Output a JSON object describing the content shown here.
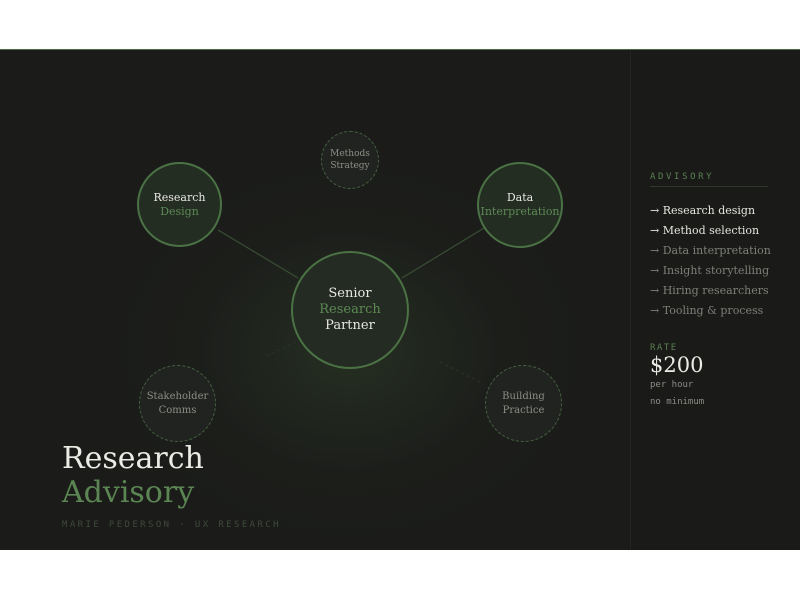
{
  "diagram": {
    "center": {
      "line1": "Senior",
      "line2": "Research",
      "line3": "Partner"
    },
    "nodes": {
      "research_design": {
        "line1": "Research",
        "line2": "Design"
      },
      "data_interpretation": {
        "line1": "Data",
        "line2": "Interpretation"
      },
      "methods_strategy": {
        "line1": "Methods",
        "line2": "Strategy"
      },
      "stakeholder_comms": {
        "line1": "Stakeholder",
        "line2": "Comms"
      },
      "building_practice": {
        "line1": "Building",
        "line2": "Practice"
      }
    }
  },
  "title": {
    "line1": "Research",
    "line2": "Advisory"
  },
  "byline": "MARIE PEDERSON · UX RESEARCH",
  "sidebar": {
    "heading": "ADVISORY",
    "items": [
      {
        "label": "→ Research design",
        "highlighted": true
      },
      {
        "label": "→ Method selection",
        "highlighted": true
      },
      {
        "label": "→ Data interpretation",
        "highlighted": false
      },
      {
        "label": "→ Insight storytelling",
        "highlighted": false
      },
      {
        "label": "→ Hiring researchers",
        "highlighted": false
      },
      {
        "label": "→ Tooling & process",
        "highlighted": false
      }
    ],
    "rate": {
      "label": "RATE",
      "value": "$200",
      "per": "per hour",
      "minimum": "no minimum"
    }
  },
  "colors": {
    "accent": "#5b8552",
    "background": "#1b1c1a",
    "text": "#ecebe5"
  }
}
